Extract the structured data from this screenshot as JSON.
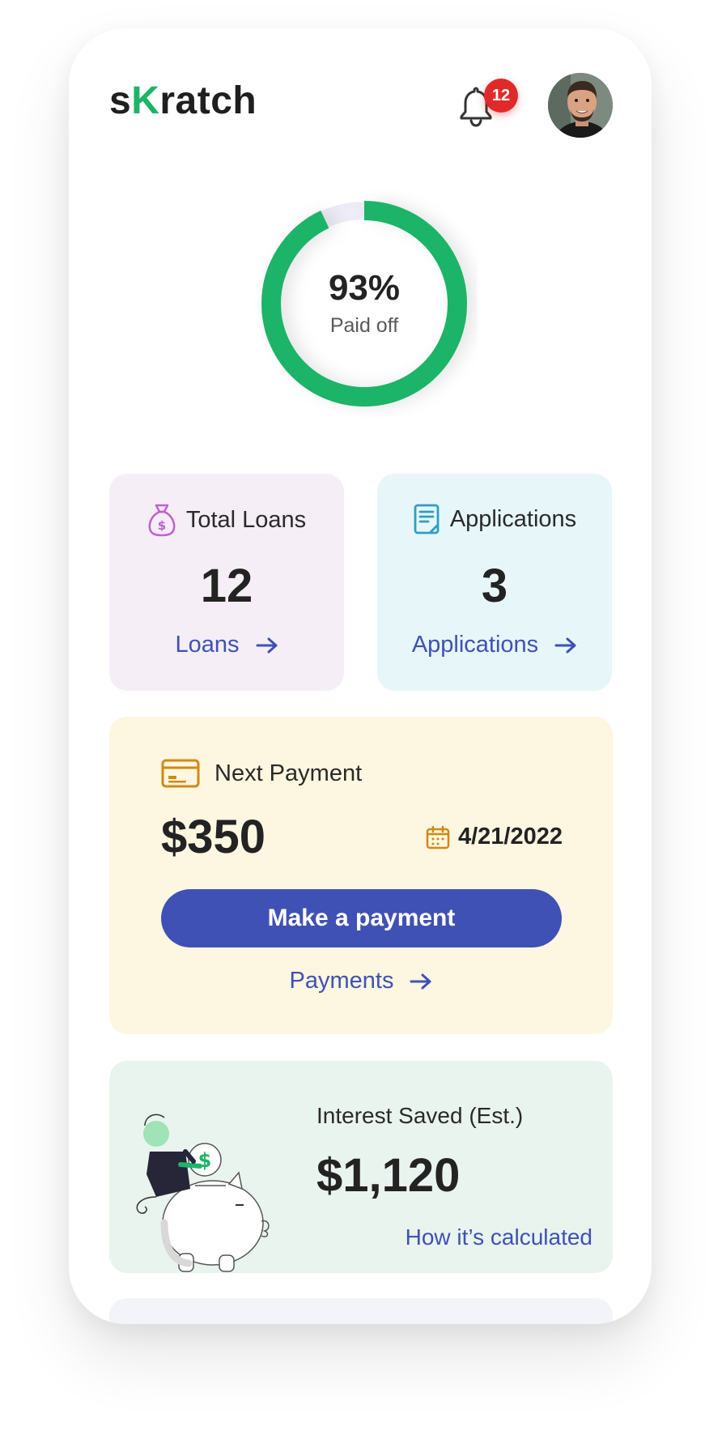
{
  "header": {
    "logo_prefix": "s",
    "logo_k": "K",
    "logo_suffix": "ratch",
    "notification_count": "12"
  },
  "progress": {
    "percent": 93,
    "percent_label": "93%",
    "label": "Paid off",
    "color": "#1db467",
    "track_color": "#ecebf6"
  },
  "loans_card": {
    "title": "Total Loans",
    "value": "12",
    "link_label": "Loans"
  },
  "applications_card": {
    "title": "Applications",
    "value": "3",
    "link_label": "Applications"
  },
  "payment_card": {
    "title": "Next Payment",
    "amount": "$350",
    "due_date": "4/21/2022",
    "button_label": "Make a payment",
    "link_label": "Payments"
  },
  "interest_card": {
    "title": "Interest Saved (Est.)",
    "amount": "$1,120",
    "link_label": "How it’s calculated"
  },
  "colors": {
    "accent": "#3f51b5",
    "brand_green": "#1db467",
    "badge_red": "#e02a2a"
  },
  "icons": {
    "bell": "bell-icon",
    "money_bag": "money-bag-icon",
    "document": "document-icon",
    "credit_card": "credit-card-icon",
    "calendar": "calendar-icon",
    "arrow": "arrow-right-icon"
  }
}
